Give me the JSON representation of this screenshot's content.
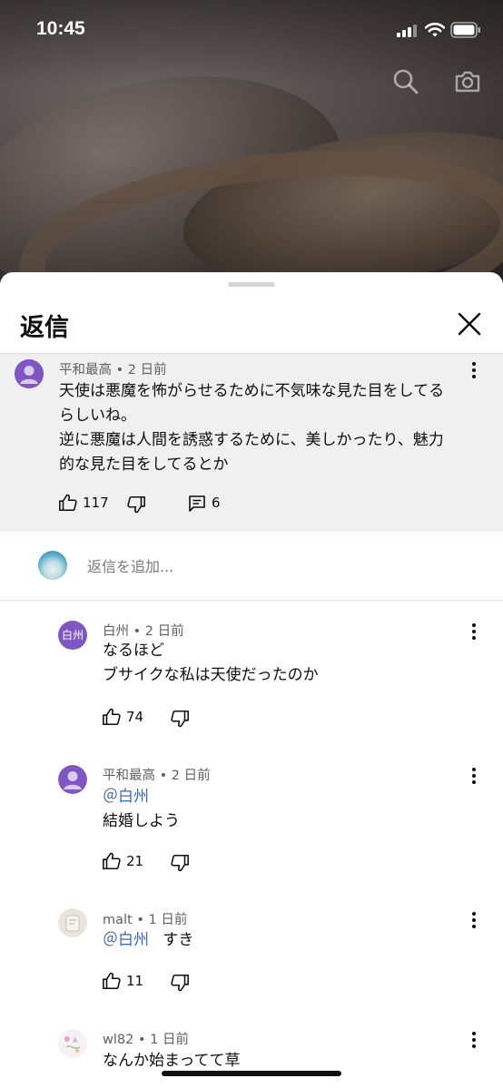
{
  "status_bar": {
    "time": "10:45"
  },
  "video": {
    "search_icon": "search-icon",
    "camera_icon": "camera-icon"
  },
  "sheet": {
    "title": "返信",
    "close_icon": "close-icon"
  },
  "parent_comment": {
    "author": "平和最高",
    "age": "2 日前",
    "lines": [
      "天使は悪魔を怖がらせるために不気味な見た目をしてる",
      "らしいね。",
      "逆に悪魔は人間を誘惑するために、美しかったり、魅力",
      "的な見た目をしてるとか"
    ],
    "likes": "117",
    "replies": "6"
  },
  "add_reply": {
    "placeholder": "返信を追加..."
  },
  "replies": [
    {
      "author": "白州",
      "age": "2 日前",
      "avatar_text": "白州",
      "avatar_color": "#7e57c2",
      "lines": [
        "なるほど",
        "ブサイクな私は天使だったのか"
      ],
      "likes": "74"
    },
    {
      "author": "平和最高",
      "age": "2 日前",
      "avatar_color": "#7e57c2",
      "mention": "＠白州",
      "lines": [
        "結婚しよう"
      ],
      "likes": "21"
    },
    {
      "author": "malt",
      "age": "1 日前",
      "mention": "＠白州",
      "inline_text": "すき",
      "likes": "11"
    },
    {
      "author": "wl82",
      "age": "1 日前",
      "lines": [
        "なんか始まってて草"
      ]
    }
  ],
  "colors": {
    "accent_link": "#3567c8",
    "avatar_purple": "#7e57c2",
    "parent_bg": "#f0f0f0"
  }
}
